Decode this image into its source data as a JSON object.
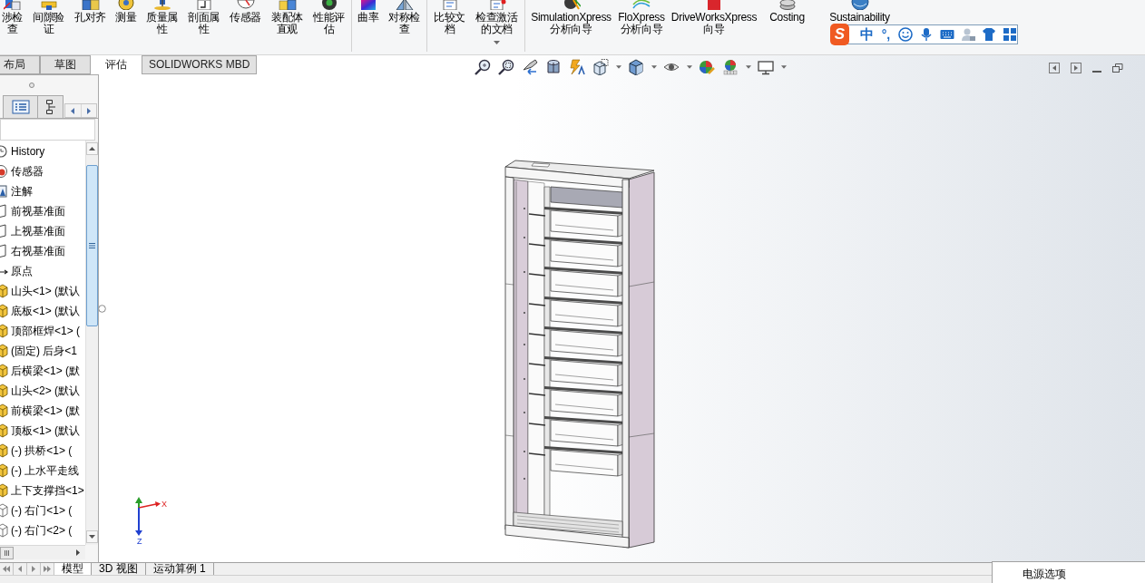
{
  "ribbon": {
    "groups": [
      {
        "items": [
          {
            "label": "涉检查",
            "has_menu": false
          },
          {
            "label": "间隙验证",
            "has_menu": false
          },
          {
            "label": "孔对齐",
            "has_menu": false
          },
          {
            "label": "测量",
            "has_menu": false
          },
          {
            "label": "质量属性",
            "has_menu": false
          },
          {
            "label": "剖面属性",
            "has_menu": false
          },
          {
            "label": "传感器",
            "has_menu": false
          },
          {
            "label": "装配体直观",
            "has_menu": false
          },
          {
            "label": "性能评估",
            "has_menu": false
          }
        ]
      },
      {
        "items": [
          {
            "label": "曲率",
            "has_menu": false
          },
          {
            "label": "对称检查",
            "has_menu": false
          }
        ]
      },
      {
        "items": [
          {
            "label": "比较文档",
            "has_menu": false
          },
          {
            "label": "检查激活的文档",
            "has_menu": true
          }
        ]
      },
      {
        "items": [
          {
            "label": "SimulationXpress\n分析向导",
            "has_menu": false
          },
          {
            "label": "FloXpress\n分析向导",
            "has_menu": false
          },
          {
            "label": "DriveWorksXpress\n向导",
            "has_menu": false
          },
          {
            "label": "Costing",
            "has_menu": false
          },
          {
            "label": "Sustainability",
            "has_menu": false
          }
        ]
      }
    ]
  },
  "ime_toolbar": {
    "logo": "S",
    "mode": "中",
    "punctuation": "°,"
  },
  "command_tabs": [
    {
      "label": "布局",
      "selected": false
    },
    {
      "label": "草图",
      "selected": false
    },
    {
      "label": "评估",
      "selected": true
    },
    {
      "label": "SOLIDWORKS MBD",
      "selected": false
    }
  ],
  "view_toolbar": [
    {
      "has_menu": false
    },
    {
      "has_menu": false
    },
    {
      "has_menu": false
    },
    {
      "has_menu": false
    },
    {
      "has_menu": false
    },
    {
      "has_menu": true
    },
    {
      "has_menu": true
    },
    {
      "has_menu": true
    },
    {
      "has_menu": false
    },
    {
      "has_menu": true
    },
    {
      "has_menu": true
    }
  ],
  "feature_tree": {
    "items": [
      {
        "label": "History",
        "kind": "history"
      },
      {
        "label": "传感器",
        "kind": "sensor"
      },
      {
        "label": "注解",
        "kind": "annotation"
      },
      {
        "label": "前视基准面",
        "kind": "plane"
      },
      {
        "label": "上视基准面",
        "kind": "plane"
      },
      {
        "label": "右视基准面",
        "kind": "plane"
      },
      {
        "label": "原点",
        "kind": "origin"
      },
      {
        "label": "山头<1> (默认",
        "kind": "part"
      },
      {
        "label": "底板<1> (默认",
        "kind": "part"
      },
      {
        "label": "顶部框焊<1> (",
        "kind": "part"
      },
      {
        "label": "(固定) 后身<1",
        "kind": "part"
      },
      {
        "label": "后横梁<1> (默",
        "kind": "part"
      },
      {
        "label": "山头<2> (默认",
        "kind": "part"
      },
      {
        "label": "前横梁<1> (默",
        "kind": "part"
      },
      {
        "label": "顶板<1> (默认",
        "kind": "part"
      },
      {
        "label": "(-) 拱桥<1> (",
        "kind": "part"
      },
      {
        "label": "(-) 上水平走线",
        "kind": "part"
      },
      {
        "label": "上下支撑挡<1>",
        "kind": "part"
      },
      {
        "label": "(-) 右门<1> (",
        "kind": "hidden_part"
      },
      {
        "label": "(-) 右门<2> (",
        "kind": "hidden_part"
      }
    ]
  },
  "triad": {
    "x_label": "X",
    "z_label": "Z"
  },
  "bottom_tabs": [
    {
      "label": "模型",
      "selected": true
    },
    {
      "label": "3D 视图",
      "selected": false
    },
    {
      "label": "运动算例 1",
      "selected": false
    }
  ],
  "tooltip": {
    "text": "电源选项"
  }
}
